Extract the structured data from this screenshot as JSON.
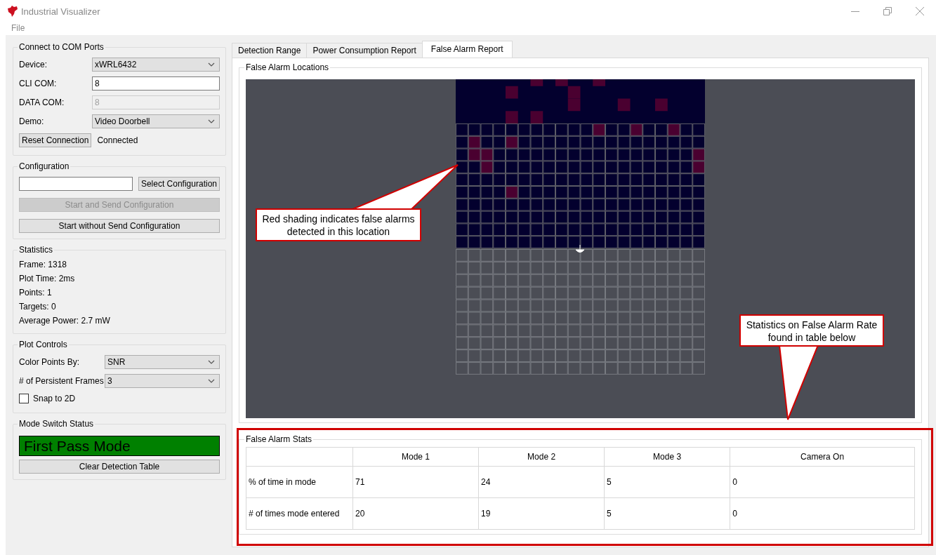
{
  "window": {
    "title": "Industrial Visualizer"
  },
  "menu": [
    "File"
  ],
  "com_ports": {
    "title": "Connect to COM Ports",
    "fields": [
      {
        "kind": "dropdown",
        "label": "Device:",
        "value": "xWRL6432"
      },
      {
        "kind": "text",
        "label": "CLI COM:",
        "value": "8",
        "disabled": false
      },
      {
        "kind": "text",
        "label": "DATA COM:",
        "value": "8",
        "disabled": true
      },
      {
        "kind": "dropdown",
        "label": "Demo:",
        "value": "Video Doorbell"
      }
    ],
    "reset_button": "Reset Connection",
    "status": "Connected"
  },
  "configuration": {
    "title": "Configuration",
    "select_button": "Select Configuration",
    "actions": [
      {
        "label": "Start and Send Configuration",
        "disabled": true
      },
      {
        "label": "Start without Send Configuration",
        "disabled": false
      }
    ]
  },
  "statistics": {
    "title": "Statistics",
    "lines": [
      "Frame: 1318",
      "Plot Time: 2ms",
      "Points: 1",
      "Targets: 0",
      "Average Power: 2.7 mW"
    ]
  },
  "plot_controls": {
    "title": "Plot Controls",
    "fields": [
      {
        "label": "Color Points By:",
        "value": "SNR"
      },
      {
        "label": "# of Persistent Frames",
        "value": "3"
      }
    ],
    "snap": {
      "label": "Snap to 2D",
      "checked": false
    }
  },
  "mode_switch": {
    "title": "Mode Switch Status",
    "mode": "First Pass Mode",
    "clear_button": "Clear Detection Table"
  },
  "tabs": [
    {
      "label": "Detection Range",
      "selected": false
    },
    {
      "label": "Power Consumption Report",
      "selected": false
    },
    {
      "label": "False Alarm Report",
      "selected": true
    }
  ],
  "locations": {
    "title": "False Alarm Locations"
  },
  "stats": {
    "title": "False Alarm Stats",
    "columns": [
      "Mode 1",
      "Mode 2",
      "Mode 3",
      "Camera On"
    ],
    "rows": [
      {
        "label": "% of time in mode",
        "cells": [
          "71",
          "24",
          "5",
          "0"
        ]
      },
      {
        "label": "# of times mode entered",
        "cells": [
          "20",
          "19",
          "5",
          "0"
        ]
      }
    ]
  },
  "annotations": [
    {
      "kind": "callout",
      "text": "Red shading indicates false alarms detected in this location"
    },
    {
      "kind": "callout",
      "text": "Statistics on False Alarm Rate found in table below"
    }
  ]
}
